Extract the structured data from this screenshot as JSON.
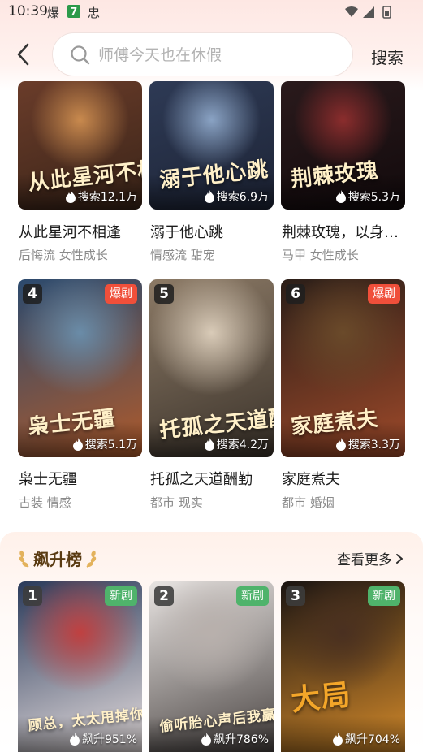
{
  "status_bar": {
    "time": "10:39",
    "notif_1": "爆",
    "notif_2": "7",
    "notif_3": "忠"
  },
  "header": {
    "search_placeholder": "师傅今天也在休假",
    "search_button": "搜索"
  },
  "grid_row_1": [
    {
      "poster_title": "从此星河不相逢",
      "stat": "搜索12.1万",
      "title": "从此星河不相逢",
      "tags": "后悔流 女性成长",
      "colors": [
        "#6a3c2a",
        "#c98a4e",
        "#3a2418"
      ]
    },
    {
      "poster_title": "溺于他心跳",
      "stat": "搜索6.9万",
      "title": "溺于他心跳",
      "tags": "情感流 甜宠",
      "colors": [
        "#2e3a55",
        "#8aa3c4",
        "#1d2436"
      ]
    },
    {
      "poster_title": "荆棘玫瑰",
      "stat": "搜索5.3万",
      "title": "荆棘玫瑰，以身入局",
      "tags": "马甲 女性成长",
      "colors": [
        "#2a1a1c",
        "#8b2d2d",
        "#120a0c"
      ]
    }
  ],
  "grid_row_2": [
    {
      "rank": "4",
      "badge": "爆剧",
      "poster_title": "枭士无疆",
      "stat": "搜索5.1万",
      "title": "枭士无疆",
      "tags": "古装 情感",
      "colors": [
        "#2b4a6e",
        "#6a8ca8",
        "#b05a2a"
      ]
    },
    {
      "rank": "5",
      "badge": "",
      "poster_title": "托孤之天道酬勤",
      "stat": "搜索4.2万",
      "title": "托孤之天道酬勤",
      "tags": "都市 现实",
      "colors": [
        "#8c7a66",
        "#d9cbb8",
        "#3a322a"
      ]
    },
    {
      "rank": "6",
      "badge": "爆剧",
      "poster_title": "家庭煮夫",
      "stat": "搜索3.3万",
      "title": "家庭煮夫",
      "tags": "都市 婚姻",
      "colors": [
        "#2a1e18",
        "#6a4a2a",
        "#a04a2a"
      ]
    }
  ],
  "section": {
    "title": "飙升榜",
    "see_more": "查看更多"
  },
  "rising": [
    {
      "rank": "1",
      "badge": "新剧",
      "poster_title": "顾总，太太甩掉你了",
      "stat": "飙升951%",
      "colors": [
        "#2a3a5a",
        "#c04040",
        "#e8e0e0"
      ]
    },
    {
      "rank": "2",
      "badge": "新剧",
      "poster_title": "偷听胎心声后我赢麻了",
      "stat": "飙升786%",
      "colors": [
        "#e8e4e2",
        "#b8b0ac",
        "#4a4442"
      ]
    },
    {
      "rank": "3",
      "badge": "新剧",
      "poster_title": "大局",
      "stat": "飙升704%",
      "colors": [
        "#1a1412",
        "#4a3020",
        "#d48a2a"
      ]
    }
  ],
  "icons": {
    "back": "chevron-left-icon",
    "search": "search-icon",
    "flame": "flame-icon",
    "more": "chevron-right-icon"
  },
  "theme": {
    "accent": "#f04f3a",
    "new_badge": "#4fb36b",
    "section_title": "#5a3b12"
  }
}
